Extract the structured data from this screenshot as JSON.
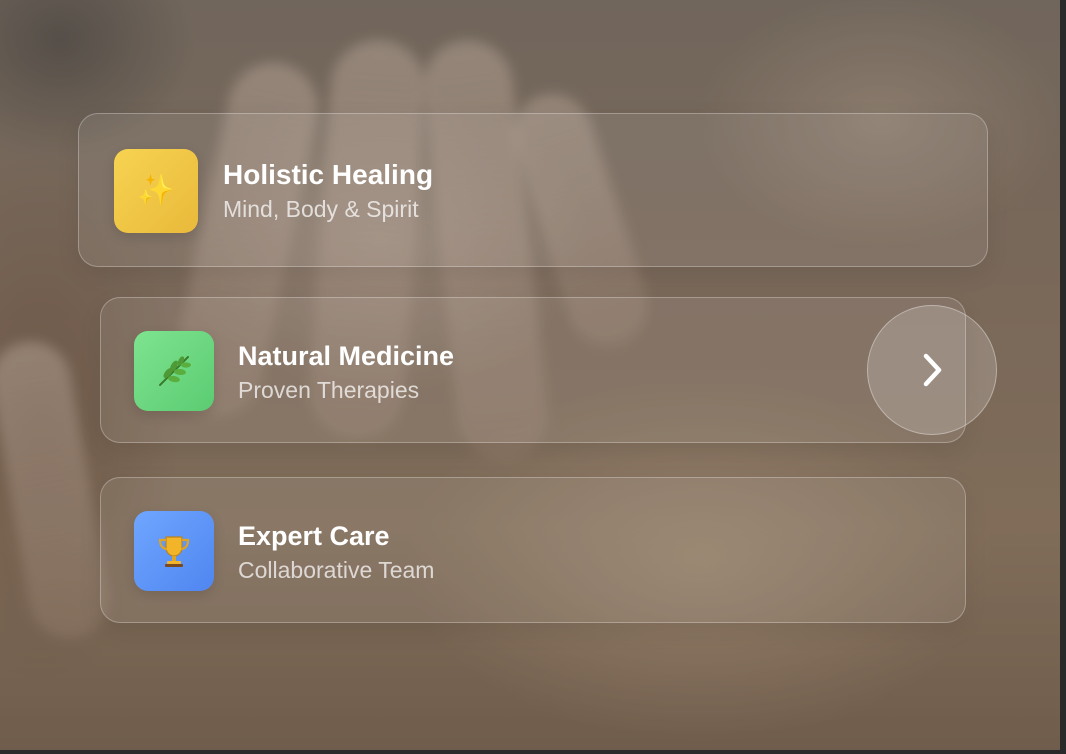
{
  "cards": [
    {
      "title": "Holistic Healing",
      "subtitle": "Mind, Body & Spirit",
      "icon": "sparkles-icon",
      "icon_glyph": "✨",
      "tile_color": "#f0c745"
    },
    {
      "title": "Natural Medicine",
      "subtitle": "Proven Therapies",
      "icon": "herb-leaf-icon",
      "tile_color": "#6cd880"
    },
    {
      "title": "Expert Care",
      "subtitle": "Collaborative Team",
      "icon": "trophy-icon",
      "tile_color": "#5f96f8"
    }
  ],
  "next_button": {
    "icon": "chevron-right-icon"
  }
}
